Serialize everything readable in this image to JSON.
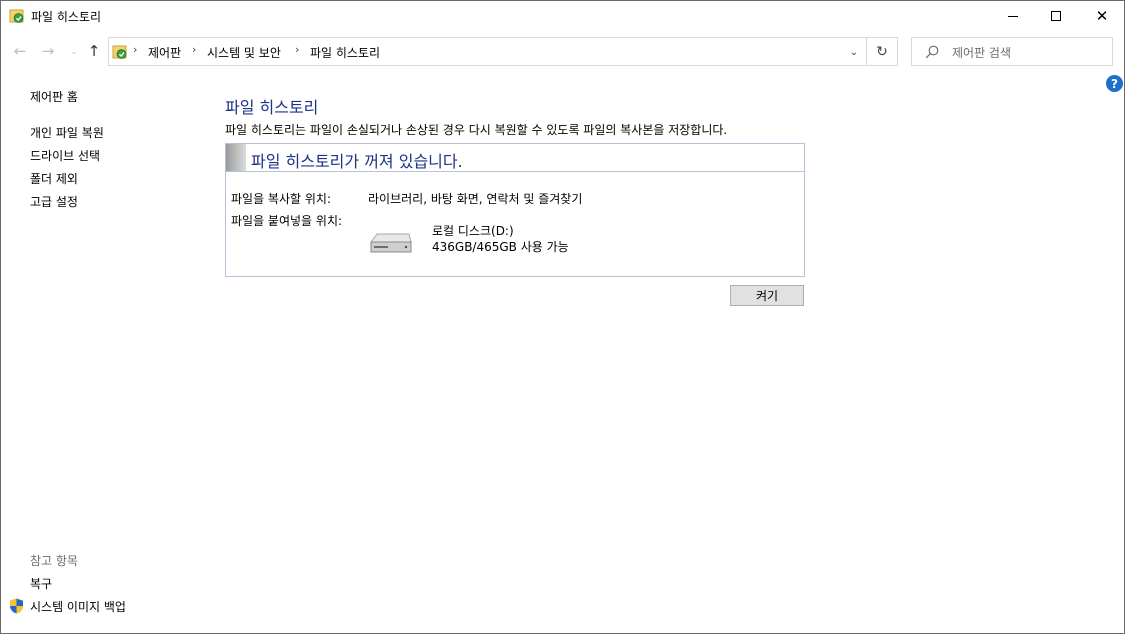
{
  "window": {
    "title": "파일 히스토리",
    "minimize_label": "minimize",
    "maximize_label": "maximize",
    "close_glyph": "✕"
  },
  "nav": {
    "back_glyph": "←",
    "forward_glyph": "→",
    "recent_glyph": "⌄",
    "up_glyph": "↑",
    "separator": "›",
    "breadcrumbs": [
      "제어판",
      "시스템 및 보안",
      "파일 히스토리"
    ],
    "dropdown_glyph": "⌄",
    "refresh_glyph": "↻"
  },
  "search": {
    "placeholder": "제어판 검색"
  },
  "help": {
    "glyph": "?"
  },
  "sidebar": {
    "home": "제어판 홈",
    "items": [
      {
        "label": "개인 파일 복원"
      },
      {
        "label": "드라이브 선택"
      },
      {
        "label": "폴더 제외"
      },
      {
        "label": "고급 설정"
      }
    ],
    "see_also_heading": "참고 항목",
    "see_also": [
      {
        "label": "복구"
      },
      {
        "label": "시스템 이미지 백업"
      }
    ]
  },
  "main": {
    "title": "파일 히스토리",
    "description": "파일 히스토리는 파일이 손실되거나 손상된 경우 다시 복원할 수 있도록 파일의 복사본을 저장합니다.",
    "status_title": "파일 히스토리가 꺼져 있습니다.",
    "copy_from_label": "파일을 복사할 위치:",
    "copy_from_value": "라이브러리, 바탕 화면, 연락처 및 즐겨찾기",
    "copy_to_label": "파일을 붙여넣을 위치:",
    "drive_name": "로컬 디스크(D:)",
    "drive_space": "436GB/465GB 사용 가능",
    "turn_on_button": "켜기"
  },
  "colors": {
    "heading_blue": "#1e3287",
    "help_blue": "#1e6fc8",
    "panel_border": "#b4c3d7"
  }
}
